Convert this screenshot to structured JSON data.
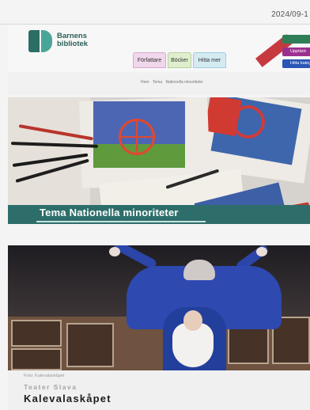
{
  "date": "2024/09-1",
  "site": {
    "logo_line1": "Barnens",
    "logo_line2": "bibliotek"
  },
  "nav": {
    "tabs": [
      {
        "label": "Författare",
        "color": "#f0d7ec"
      },
      {
        "label": "Böcker",
        "color": "#dfeecf"
      },
      {
        "label": "Hitta mer",
        "color": "#d4ebf2"
      }
    ]
  },
  "header_buttons": [
    "",
    "Upptäck",
    "Hitta kategori"
  ],
  "breadcrumb": [
    "Hem",
    "Tema",
    "Nationella minoriteter"
  ],
  "hero1": {
    "title": "Tema Nationella minoriteter",
    "band_color": "#2d6e6b"
  },
  "hero2": {
    "caption_small": "Foto: Kalevalaskåpet",
    "organizer": "Teater Slava",
    "title": "Kalevalaskåpet"
  }
}
